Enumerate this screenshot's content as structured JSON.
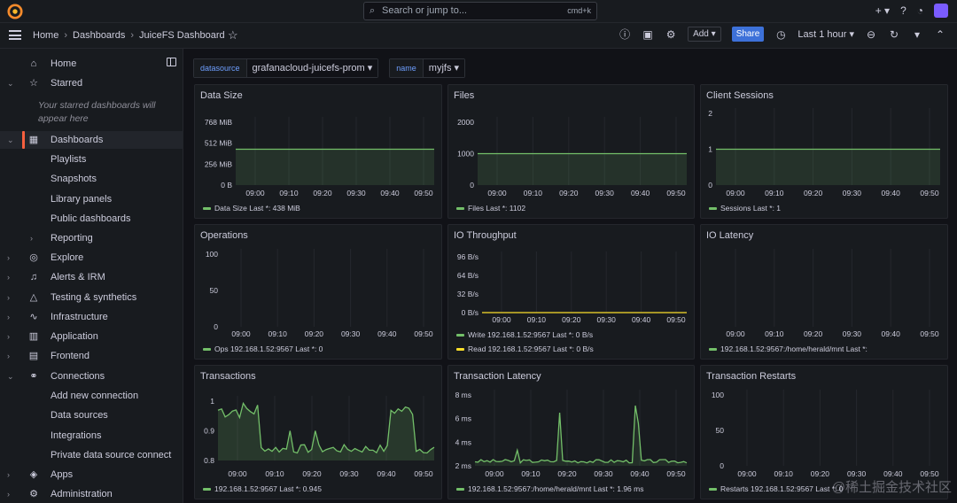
{
  "topbar": {
    "search_placeholder": "Search or jump to...",
    "search_shortcut": "cmd+k",
    "icons": [
      "plus-icon",
      "help-icon",
      "rss-icon",
      "avatar"
    ]
  },
  "navbar": {
    "breadcrumbs": [
      "Home",
      "Dashboards",
      "JuiceFS Dashboard"
    ],
    "add_label": "Add",
    "share_label": "Share",
    "time_range": "Last 1 hour"
  },
  "sidebar": {
    "items": [
      {
        "label": "Home",
        "icon": "home-icon"
      },
      {
        "label": "Starred",
        "icon": "star-icon"
      },
      {
        "label": "Dashboards",
        "icon": "dashboards-icon"
      },
      {
        "label": "Playlists"
      },
      {
        "label": "Snapshots"
      },
      {
        "label": "Library panels"
      },
      {
        "label": "Public dashboards"
      },
      {
        "label": "Reporting"
      },
      {
        "label": "Explore",
        "icon": "explore-icon"
      },
      {
        "label": "Alerts & IRM",
        "icon": "bell-icon"
      },
      {
        "label": "Testing & synthetics",
        "icon": "testing-icon"
      },
      {
        "label": "Infrastructure",
        "icon": "infrastructure-icon"
      },
      {
        "label": "Application",
        "icon": "application-icon"
      },
      {
        "label": "Frontend",
        "icon": "frontend-icon"
      },
      {
        "label": "Connections",
        "icon": "connections-icon"
      },
      {
        "label": "Add new connection"
      },
      {
        "label": "Data sources"
      },
      {
        "label": "Integrations"
      },
      {
        "label": "Private data source connect"
      },
      {
        "label": "Apps",
        "icon": "apps-icon"
      },
      {
        "label": "Administration",
        "icon": "gear-icon"
      }
    ],
    "starred_note": "Your starred dashboards will appear here"
  },
  "variables": [
    {
      "key": "datasource",
      "value": "grafanacloud-juicefs-prom"
    },
    {
      "key": "name",
      "value": "myjfs"
    }
  ],
  "x_ticks": [
    "09:00",
    "09:10",
    "09:20",
    "09:30",
    "09:40",
    "09:50"
  ],
  "panels": {
    "data_size": {
      "title": "Data Size",
      "y_ticks": [
        "768 MiB",
        "512 MiB",
        "256 MiB",
        "0 B"
      ],
      "legend": [
        "Data Size  Last *: 438 MiB"
      ]
    },
    "files": {
      "title": "Files",
      "y_ticks": [
        "2000",
        "1000",
        "0"
      ],
      "legend": [
        "Files  Last *: 1102"
      ]
    },
    "client_sessions": {
      "title": "Client Sessions",
      "y_ticks": [
        "2",
        "1",
        "0"
      ],
      "legend": [
        "Sessions  Last *: 1"
      ]
    },
    "operations": {
      "title": "Operations",
      "y_ticks": [
        "100",
        "50",
        "0"
      ],
      "legend": [
        "Ops 192.168.1.52:9567  Last *: 0"
      ]
    },
    "io_throughput": {
      "title": "IO Throughput",
      "y_ticks": [
        "96 B/s",
        "64 B/s",
        "32 B/s",
        "0 B/s"
      ],
      "legend": [
        "Write 192.168.1.52:9567  Last *: 0 B/s",
        "Read 192.168.1.52:9567  Last *: 0 B/s"
      ]
    },
    "io_latency": {
      "title": "IO Latency",
      "y_ticks": [],
      "legend": [
        "192.168.1.52:9567:/home/herald/mnt  Last *:"
      ]
    },
    "transactions": {
      "title": "Transactions",
      "y_ticks": [
        "1",
        "0.9",
        "0.8"
      ],
      "legend": [
        "192.168.1.52:9567  Last *: 0.945"
      ]
    },
    "transaction_latency": {
      "title": "Transaction Latency",
      "y_ticks": [
        "8 ms",
        "6 ms",
        "4 ms",
        "2 ms"
      ],
      "legend": [
        "192.168.1.52:9567:/home/herald/mnt  Last *: 1.96 ms"
      ]
    },
    "transaction_restarts": {
      "title": "Transaction Restarts",
      "y_ticks": [
        "100",
        "50",
        "0"
      ],
      "legend": [
        "Restarts 192.168.1.52:9567  Last *: 0"
      ]
    }
  },
  "colors": {
    "green": "#73bf69",
    "yellow": "#fade2a",
    "grafana_orange": "#f55f3e",
    "primary": "#3d71d9"
  },
  "watermark": "@稀土掘金技术社区"
}
